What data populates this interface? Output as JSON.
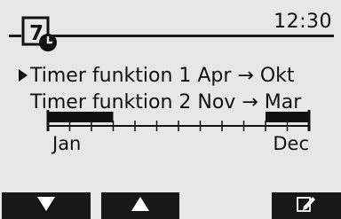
{
  "header": {
    "icon": "timer-calendar-icon",
    "icon_number": "7",
    "time": "12:30"
  },
  "timer_lines": [
    {
      "text": "Timer funktion 1 Apr → Okt",
      "selected": true
    },
    {
      "text": "Timer funktion 2 Nov → Mar",
      "selected": false
    }
  ],
  "timeline": {
    "start_label": "Jan",
    "end_label": "Dec",
    "active_ranges": [
      {
        "from_month": 1,
        "to_month": 3
      },
      {
        "from_month": 11,
        "to_month": 12
      }
    ]
  },
  "softkeys": {
    "down": "arrow-down-icon",
    "up": "arrow-up-icon",
    "edit": "edit-pencil-icon"
  },
  "colors": {
    "background": "#e6e8e7",
    "foreground": "#171717"
  }
}
